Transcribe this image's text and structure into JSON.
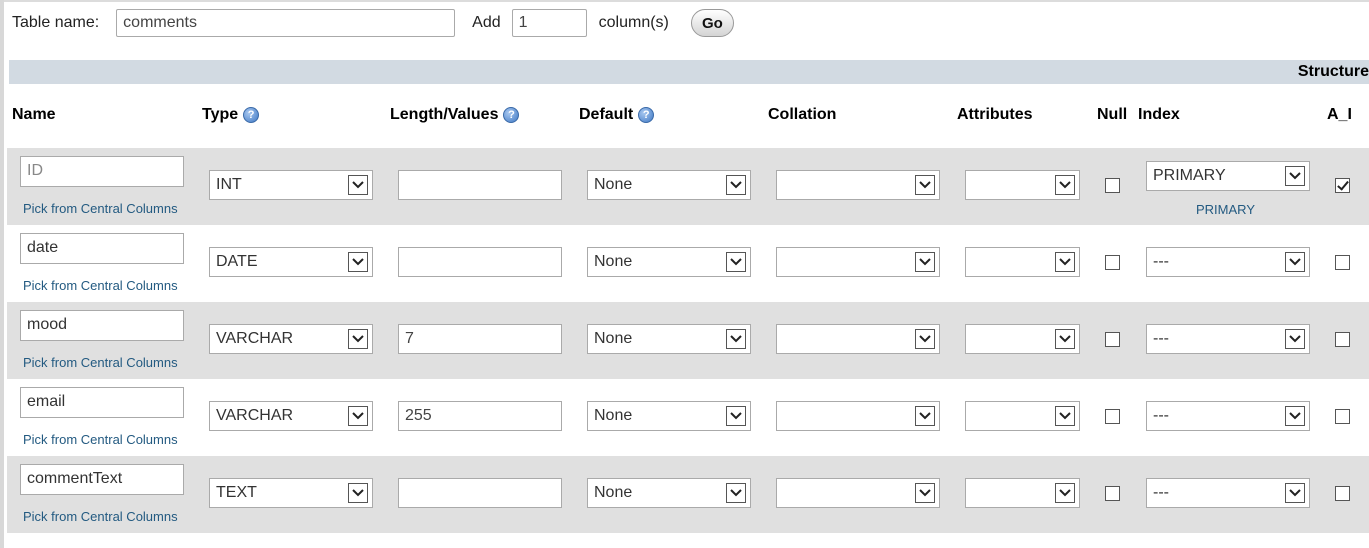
{
  "toolbar": {
    "table_name_label": "Table name:",
    "table_name_value": "comments",
    "add_label": "Add",
    "add_count": "1",
    "columns_label": "column(s)",
    "go_label": "Go"
  },
  "structure_label": "Structure",
  "headers": {
    "name": "Name",
    "type": "Type",
    "length": "Length/Values",
    "default": "Default",
    "collation": "Collation",
    "attributes": "Attributes",
    "null": "Null",
    "index": "Index",
    "ai": "A_I",
    "help_glyph": "?"
  },
  "pick_label": "Pick from Central Columns",
  "rows": [
    {
      "name": "ID",
      "type": "INT",
      "length": "",
      "default": "None",
      "collation": "",
      "attributes": "",
      "null": false,
      "index": "PRIMARY",
      "index_link": "PRIMARY",
      "ai": true
    },
    {
      "name": "date",
      "type": "DATE",
      "length": "",
      "default": "None",
      "collation": "",
      "attributes": "",
      "null": false,
      "index": "---",
      "index_link": "",
      "ai": false
    },
    {
      "name": "mood",
      "type": "VARCHAR",
      "length": "7",
      "default": "None",
      "collation": "",
      "attributes": "",
      "null": false,
      "index": "---",
      "index_link": "",
      "ai": false
    },
    {
      "name": "email",
      "type": "VARCHAR",
      "length": "255",
      "default": "None",
      "collation": "",
      "attributes": "",
      "null": false,
      "index": "---",
      "index_link": "",
      "ai": false
    },
    {
      "name": "commentText",
      "type": "TEXT",
      "length": "",
      "default": "None",
      "collation": "",
      "attributes": "",
      "null": false,
      "index": "---",
      "index_link": "",
      "ai": false
    }
  ]
}
